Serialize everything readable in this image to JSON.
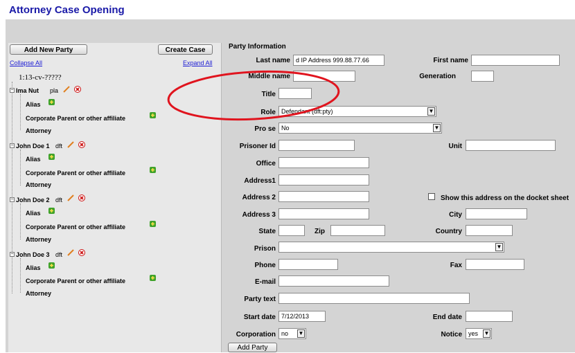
{
  "page_title": "Attorney Case Opening",
  "left": {
    "add_new_party": "Add New Party",
    "create_case": "Create Case",
    "collapse_all": "Collapse All",
    "expand_all": "Expand All",
    "case_number": "1:13-cv-?????",
    "parties": [
      {
        "name": "Ima Nut",
        "role": "pla",
        "alias": "Alias",
        "corporate": "Corporate Parent or other affiliate",
        "attorney": "Attorney"
      },
      {
        "name": "John Doe 1",
        "role": "dft",
        "alias": "Alias",
        "corporate": "Corporate Parent or other affiliate",
        "attorney": "Attorney"
      },
      {
        "name": "John Doe 2",
        "role": "dft",
        "alias": "Alias",
        "corporate": "Corporate Parent or other affiliate",
        "attorney": "Attorney"
      },
      {
        "name": "John Doe 3",
        "role": "dft",
        "alias": "Alias",
        "corporate": "Corporate Parent or other affiliate",
        "attorney": "Attorney"
      }
    ]
  },
  "form": {
    "section_title": "Party Information",
    "last_name_label": "Last name",
    "last_name_value": "d IP Address 999.88.77.66",
    "first_name_label": "First name",
    "first_name_value": "",
    "middle_name_label": "Middle name",
    "middle_name_value": "",
    "generation_label": "Generation",
    "generation_value": "",
    "title_label": "Title",
    "title_value": "",
    "role_label": "Role",
    "role_value": "Defendant (dft:pty)",
    "pro_se_label": "Pro se",
    "pro_se_value": "No",
    "prisoner_id_label": "Prisoner Id",
    "prisoner_id_value": "",
    "unit_label": "Unit",
    "unit_value": "",
    "office_label": "Office",
    "office_value": "",
    "address1_label": "Address1",
    "address1_value": "",
    "address2_label": "Address 2",
    "address2_value": "",
    "show_address_label": "Show this address on the docket sheet",
    "show_address_checked": false,
    "address3_label": "Address 3",
    "address3_value": "",
    "city_label": "City",
    "city_value": "",
    "state_label": "State",
    "state_value": "",
    "zip_label": "Zip",
    "zip_value": "",
    "country_label": "Country",
    "country_value": "",
    "prison_label": "Prison",
    "prison_value": "",
    "phone_label": "Phone",
    "phone_value": "",
    "fax_label": "Fax",
    "fax_value": "",
    "email_label": "E-mail",
    "email_value": "",
    "party_text_label": "Party text",
    "party_text_value": "",
    "start_date_label": "Start date",
    "start_date_value": "7/12/2013",
    "end_date_label": "End date",
    "end_date_value": "",
    "corporation_label": "Corporation",
    "corporation_value": "no",
    "notice_label": "Notice",
    "notice_value": "yes",
    "add_party_button": "Add Party"
  },
  "colors": {
    "title_blue": "#1a1aa8",
    "link_blue": "#1b1bd4",
    "highlight_red": "#e0141e",
    "panel_gray": "#d4d4d4"
  },
  "icons": [
    "plus-green-icon",
    "pencil-icon",
    "delete-x-icon",
    "chevron-down-icon",
    "tree-minus-icon"
  ]
}
